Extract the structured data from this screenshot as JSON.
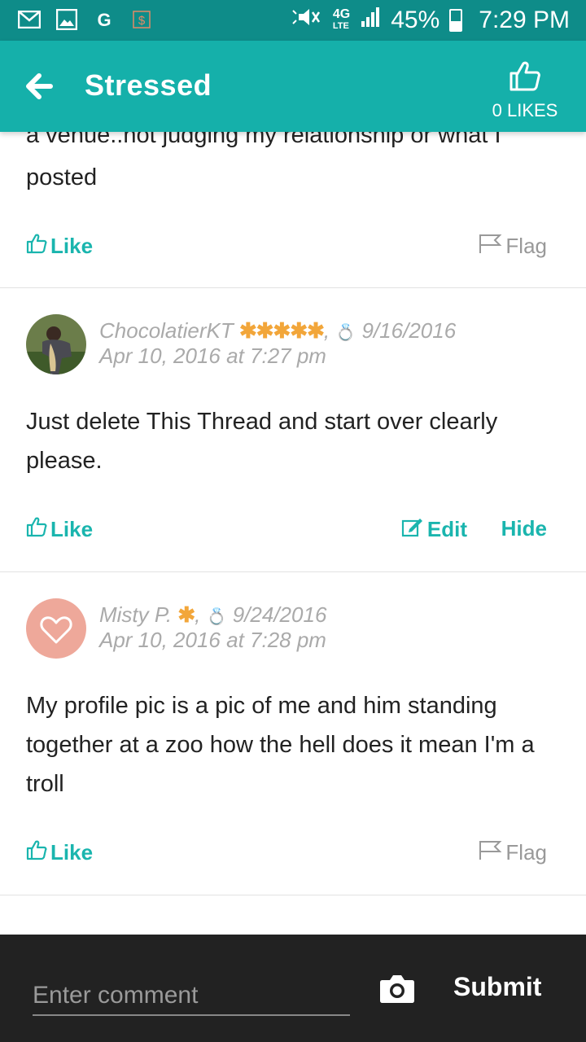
{
  "status_bar": {
    "network_label": "4G",
    "network_sub": "LTE",
    "battery": "45%",
    "battery_level": 0.45,
    "time": "7:29 PM",
    "icons": [
      "mail-icon",
      "image-icon",
      "google-icon",
      "dollar-icon",
      "mute-icon",
      "signal-icon",
      "battery-icon"
    ]
  },
  "app_bar": {
    "title": "Stressed",
    "likes_label": "0 LIKES"
  },
  "posts": [
    {
      "partial_text_top": "a venue..not judging my relationship or what I",
      "text": "posted",
      "like_label": "Like",
      "flag_label": "Flag"
    },
    {
      "author": "ChocolatierKT",
      "stars": "✱✱✱✱✱",
      "wedding_date": "9/16/2016",
      "timestamp": "Apr 10, 2016 at 7:27 pm",
      "text": "Just delete This Thread and start over clearly please.",
      "like_label": "Like",
      "edit_label": "Edit",
      "hide_label": "Hide"
    },
    {
      "author": "Misty P.",
      "stars": "✱",
      "wedding_date": "9/24/2016",
      "timestamp": "Apr 10, 2016 at 7:28 pm",
      "text": "My profile pic is a pic of me and him standing together at a zoo how the hell does it mean I'm a troll",
      "like_label": "Like",
      "flag_label": "Flag"
    }
  ],
  "comment_bar": {
    "placeholder": "Enter comment",
    "submit_label": "Submit"
  },
  "colors": {
    "accent": "#15b0aa",
    "status_bar": "#0e8c89",
    "star": "#f2a63a",
    "avatar_pink": "#eea89a"
  }
}
